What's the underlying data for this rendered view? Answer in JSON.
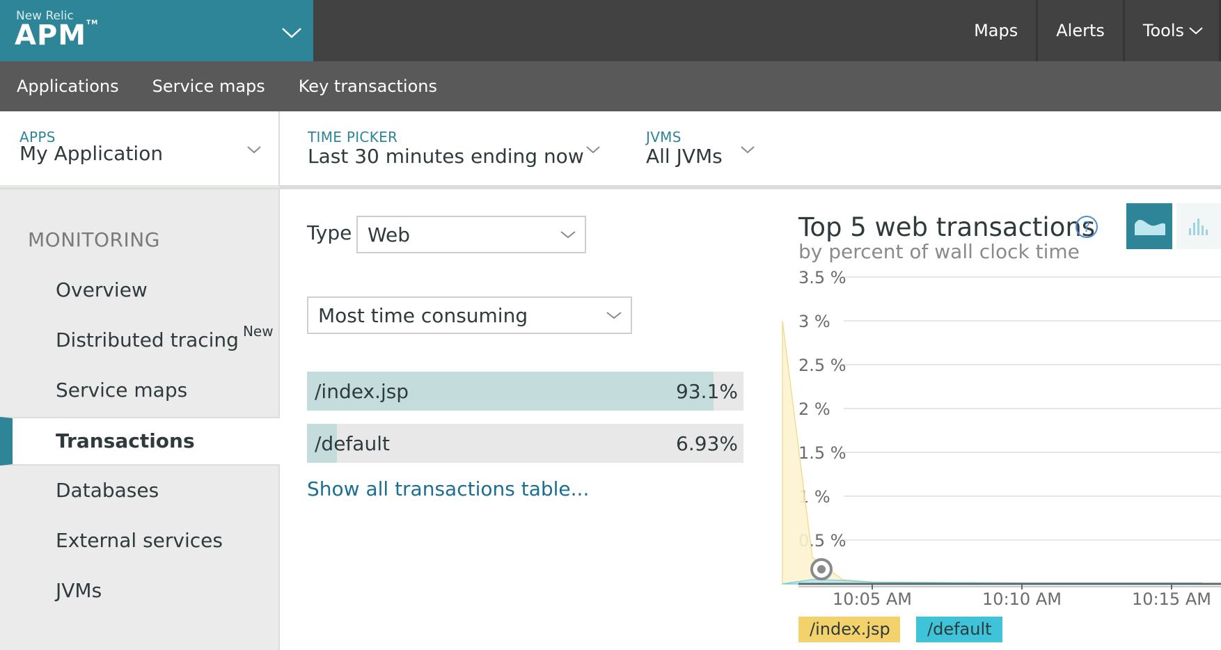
{
  "brand": {
    "small": "New Relic",
    "product": "APM",
    "tm": "TM"
  },
  "topnav": {
    "maps": "Maps",
    "alerts": "Alerts",
    "tools": "Tools"
  },
  "subnav": [
    "Applications",
    "Service maps",
    "Key transactions"
  ],
  "filters": {
    "apps": {
      "label": "APPS",
      "value": "My Application"
    },
    "time": {
      "label": "TIME PICKER",
      "value": "Last 30 minutes ending now"
    },
    "jvms": {
      "label": "JVMS",
      "value": "All JVMs"
    }
  },
  "sidebar": {
    "section": "MONITORING",
    "items": [
      "Overview",
      "Distributed tracing",
      "Service maps",
      "Transactions",
      "Databases",
      "External services",
      "JVMs"
    ],
    "new_badge": "New",
    "active": "Transactions"
  },
  "main": {
    "type_label": "Type",
    "type_value": "Web",
    "sort_value": "Most time consuming",
    "transactions": [
      {
        "name": "/index.jsp",
        "pct": "93.1%",
        "fraction": 0.931
      },
      {
        "name": "/default",
        "pct": "6.93%",
        "fraction": 0.0693
      }
    ],
    "show_all": "Show all transactions table..."
  },
  "chart_data": {
    "type": "area",
    "title": "Top 5 web transactions",
    "subtitle": "by percent of wall clock time",
    "y_ticks": [
      "3.5 %",
      "3 %",
      "2.5 %",
      "2 %",
      "1.5 %",
      "1 %",
      "0.5 %"
    ],
    "x_ticks": [
      "10:05 AM",
      "10:10 AM",
      "10:15 AM"
    ],
    "ylim": [
      0,
      3.5
    ],
    "series": [
      {
        "name": "/index.jsp",
        "color": "#fdf3d1",
        "legend_color": "#f3d26b",
        "x": [
          "10:02 AM",
          "10:03 AM",
          "10:04 AM",
          "10:05 AM",
          "10:10 AM",
          "10:15 AM",
          "10:16 AM"
        ],
        "values": [
          3.0,
          0.3,
          0.05,
          0.02,
          0.01,
          0.01,
          0.01
        ]
      },
      {
        "name": "/default",
        "color": "#bfe7ef",
        "legend_color": "#3ec3d8",
        "x": [
          "10:02 AM",
          "10:03 AM",
          "10:04 AM",
          "10:05 AM",
          "10:10 AM",
          "10:15 AM",
          "10:16 AM"
        ],
        "values": [
          0.0,
          0.05,
          0.04,
          0.02,
          0.01,
          0.01,
          0.01
        ]
      }
    ],
    "grid": true,
    "legend_position": "bottom"
  }
}
